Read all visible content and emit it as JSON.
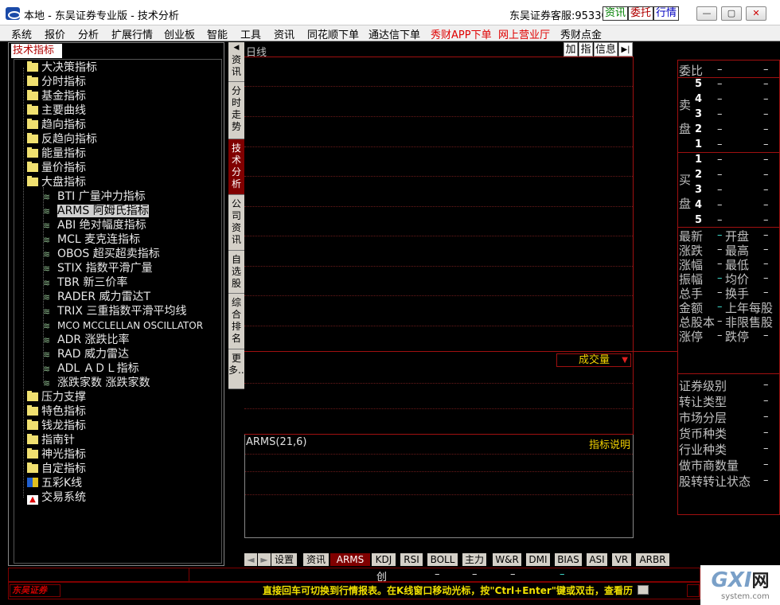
{
  "window": {
    "title": "本地 - 东吴证券专业版 - 技术分析",
    "hotline_label": "东吴证券客服:",
    "hotline_number": "95330",
    "btn_news": "资讯",
    "btn_order": "委托",
    "btn_quote": "行情",
    "min": "—",
    "max": "▢",
    "close": "✕"
  },
  "menu": [
    "系统",
    "报价",
    "分析",
    "扩展行情",
    "创业板",
    "智能",
    "工具",
    "资讯",
    "同花顺下单",
    "通达信下单",
    "秀财APP下单",
    "网上营业厅",
    "秀财点金"
  ],
  "menu_colors": {
    "normal": "#000000",
    "highlight": "#e00000"
  },
  "left": {
    "tab": "技术指标",
    "folders_top": [
      "大决策指标",
      "分时指标",
      "基金指标",
      "主要曲线",
      "趋向指标",
      "反趋向指标",
      "能量指标",
      "量价指标",
      "大盘指标"
    ],
    "indicators": [
      "BTI 广量冲力指标",
      "ARMS 阿姆氏指标",
      "ABI 绝对幅度指标",
      "MCL 麦克连指标",
      "OBOS 超买超卖指标",
      "STIX 指数平滑广量",
      "TBR 新三价率",
      "RADER 威力雷达T",
      "TRIX 三重指数平滑平均线",
      "MCO MCCLELLAN OSCILLATOR",
      "ADR 涨跌比率",
      "RAD 威力雷达",
      "ADL ＡＤＬ指标",
      "涨跌家数 涨跌家数"
    ],
    "folders_bottom": [
      "压力支撑",
      "特色指标",
      "钱龙指标",
      "指南针",
      "神光指标",
      "自定指标"
    ],
    "specials": [
      "五彩K线",
      "交易系统"
    ]
  },
  "vtabs": [
    {
      "label": "资讯",
      "active": false
    },
    {
      "label": "分时走势",
      "active": false
    },
    {
      "label": "技术分析",
      "active": true
    },
    {
      "label": "公司资讯",
      "active": false
    },
    {
      "label": "自选股",
      "active": false
    },
    {
      "label": "综合排名",
      "active": false
    },
    {
      "label": "更多...",
      "active": false
    }
  ],
  "chart": {
    "period": "日线",
    "btn_add": "加",
    "btn_ind": "指",
    "btn_info": "信息",
    "volume_label": "成交量",
    "indicator_title": "ARMS(21,6)",
    "indicator_help": "指标说明"
  },
  "quote": {
    "weibi": "委比",
    "dash": "–",
    "sell_label": "卖盘",
    "buy_label": "买盘",
    "sell_levels": [
      "5",
      "4",
      "3",
      "2",
      "1"
    ],
    "buy_levels": [
      "1",
      "2",
      "3",
      "4",
      "5"
    ],
    "stats": [
      [
        "最新",
        "开盘"
      ],
      [
        "涨跌",
        "最高"
      ],
      [
        "涨幅",
        "最低"
      ],
      [
        "振幅",
        "均价"
      ],
      [
        "总手",
        "换手"
      ],
      [
        "金额",
        "上年每股"
      ],
      [
        "总股本",
        "非限售股"
      ],
      [
        "涨停",
        "跌停"
      ]
    ],
    "info": [
      "证券级别",
      "转让类型",
      "市场分层",
      "货币种类",
      "行业种类",
      "做市商数量",
      "股转转让状态"
    ]
  },
  "bottom_tabs": [
    {
      "label": "设置",
      "active": false
    },
    {
      "label": "资讯",
      "active": false
    },
    {
      "label": "ARMS",
      "active": true
    },
    {
      "label": "KDJ",
      "active": false
    },
    {
      "label": "RSI",
      "active": false
    },
    {
      "label": "BOLL",
      "active": false
    },
    {
      "label": "主力",
      "active": false
    },
    {
      "label": "W&R",
      "active": false
    },
    {
      "label": "DMI",
      "active": false
    },
    {
      "label": "BIAS",
      "active": false
    },
    {
      "label": "ASI",
      "active": false
    },
    {
      "label": "VR",
      "active": false
    },
    {
      "label": "ARBR",
      "active": false
    }
  ],
  "status": {
    "chuang": "创",
    "d1": "–",
    "d2": "–",
    "d3": "–",
    "d4": "–"
  },
  "ticker": {
    "brand": "东吴证券",
    "text": "直接回车可切换到行情报表。在K线窗口移动光标，按\"Ctrl+Enter\"键或双击，查看历"
  },
  "watermark": {
    "brand": "GXI",
    "suffix": "网",
    "domain": "system.com"
  }
}
